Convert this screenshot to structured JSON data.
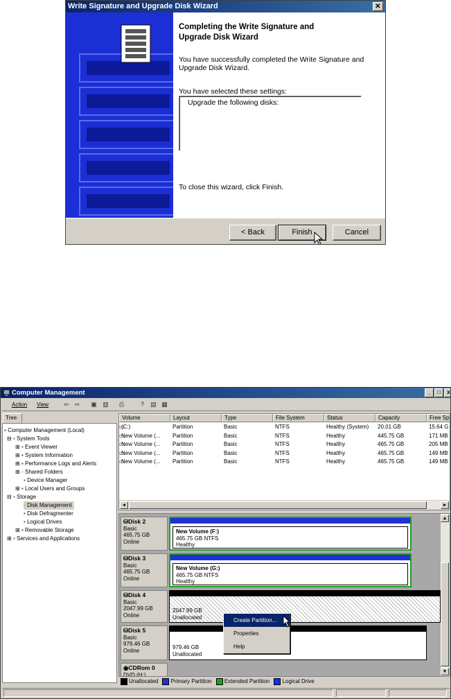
{
  "wizard": {
    "title": "Write Signature and Upgrade Disk Wizard",
    "close_label": "✕",
    "heading": "Completing the Write Signature and Upgrade Disk Wizard",
    "success_text": "You have successfully completed the Write Signature and Upgrade Disk Wizard.",
    "settings_label": "You have selected these settings:",
    "settings_content": "Upgrade the following disks:",
    "close_text": "To close this wizard, click Finish.",
    "back_label": "< Back",
    "finish_label": "Finish",
    "cancel_label": "Cancel"
  },
  "cm": {
    "title": "Computer Management",
    "menu": {
      "action": "Action",
      "view": "View"
    },
    "tree_tab": "Tree",
    "tree": [
      "Computer Management (Local)",
      "System Tools",
      "Event Viewer",
      "System Information",
      "Performance Logs and Alerts",
      "Shared Folders",
      "Device Manager",
      "Local Users and Groups",
      "Storage",
      "Disk Management",
      "Disk Defragmenter",
      "Logical Drives",
      "Removable Storage",
      "Services and Applications"
    ],
    "columns": [
      "Volume",
      "Layout",
      "Type",
      "File System",
      "Status",
      "Capacity",
      "Free Sp"
    ],
    "volumes": [
      [
        "(C:)",
        "Partition",
        "Basic",
        "NTFS",
        "Healthy (System)",
        "20.01 GB",
        "15.64 G"
      ],
      [
        "New Volume (...",
        "Partition",
        "Basic",
        "NTFS",
        "Healthy",
        "445.75 GB",
        "171 MB"
      ],
      [
        "New Volume (...",
        "Partition",
        "Basic",
        "NTFS",
        "Healthy",
        "465.75 GB",
        "205 MB"
      ],
      [
        "New Volume (...",
        "Partition",
        "Basic",
        "NTFS",
        "Healthy",
        "465.75 GB",
        "149 MB"
      ],
      [
        "New Volume (...",
        "Partition",
        "Basic",
        "NTFS",
        "Healthy",
        "465.75 GB",
        "149 MB"
      ]
    ],
    "disks": {
      "disk2": {
        "name": "Disk 2",
        "type": "Basic",
        "size": "465.75 GB",
        "state": "Online",
        "vol_name": "New Volume (F:)",
        "vol_size": "465.75 GB NTFS",
        "vol_status": "Healthy"
      },
      "disk3": {
        "name": "Disk 3",
        "type": "Basic",
        "size": "465.75 GB",
        "state": "Online",
        "vol_name": "New Volume (G:)",
        "vol_size": "465.75 GB NTFS",
        "vol_status": "Healthy"
      },
      "disk4": {
        "name": "Disk 4",
        "type": "Basic",
        "size": "2047.99 GB",
        "state": "Online",
        "part_size": "2047.99 GB",
        "part_status": "Unallocated"
      },
      "disk5": {
        "name": "Disk 5",
        "type": "Basic",
        "size": "979.46 GB",
        "state": "Online",
        "part_size": "979.46 GB",
        "part_status": "Unallocated"
      },
      "cdrom": {
        "name": "CDRom 0",
        "type": "DVD (H:)"
      }
    },
    "context_menu": [
      "Create Partition...",
      "Properties",
      "Help"
    ],
    "legend": [
      "Unallocated",
      "Primary Partition",
      "Extended Partition",
      "Logical Drive"
    ],
    "colors": {
      "unallocated": "#000000",
      "primary": "#2030d8",
      "extended": "#20a020",
      "logical": "#1830e8"
    }
  }
}
